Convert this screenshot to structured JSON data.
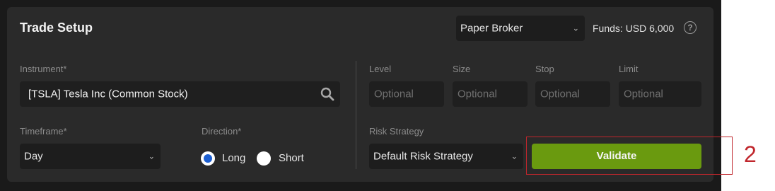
{
  "header": {
    "title": "Trade Setup",
    "broker": "Paper Broker",
    "funds": "Funds: USD 6,000",
    "help_glyph": "?"
  },
  "left": {
    "instrument_label": "Instrument*",
    "instrument_value": "[TSLA] Tesla Inc (Common Stock)",
    "timeframe_label": "Timeframe*",
    "timeframe_value": "Day",
    "direction_label": "Direction*",
    "direction_options": [
      {
        "label": "Long",
        "selected": true
      },
      {
        "label": "Short",
        "selected": false
      }
    ]
  },
  "right": {
    "level_label": "Level",
    "size_label": "Size",
    "stop_label": "Stop",
    "limit_label": "Limit",
    "placeholder": "Optional",
    "risk_label": "Risk Strategy",
    "risk_value": "Default Risk Strategy",
    "validate_label": "Validate"
  },
  "annotation": {
    "number": "2",
    "color": "#c0262c"
  },
  "colors": {
    "accent_green": "#6a9a0f",
    "radio_blue": "#1c5fd1",
    "panel": "#2a2a2a"
  },
  "icons": {
    "search": "search-icon",
    "chevron": "chevron-down-icon",
    "help": "help-icon"
  }
}
